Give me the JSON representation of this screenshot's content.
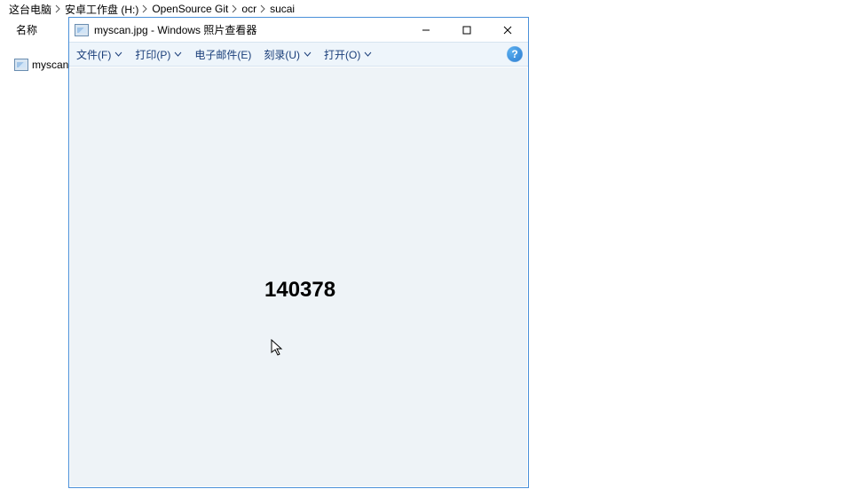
{
  "breadcrumb": {
    "items": [
      "这台电脑",
      "安卓工作盘 (H:)",
      "OpenSource Git",
      "ocr",
      "sucai"
    ]
  },
  "explorer": {
    "column_header": "名称",
    "file_name": "myscan.j"
  },
  "viewer": {
    "title": "myscan.jpg - Windows 照片查看器",
    "menu": {
      "file": "文件(F)",
      "print": "打印(P)",
      "email": "电子邮件(E)",
      "burn": "刻录(U)",
      "open": "打开(O)"
    },
    "help_glyph": "?",
    "image_text": "140378"
  }
}
